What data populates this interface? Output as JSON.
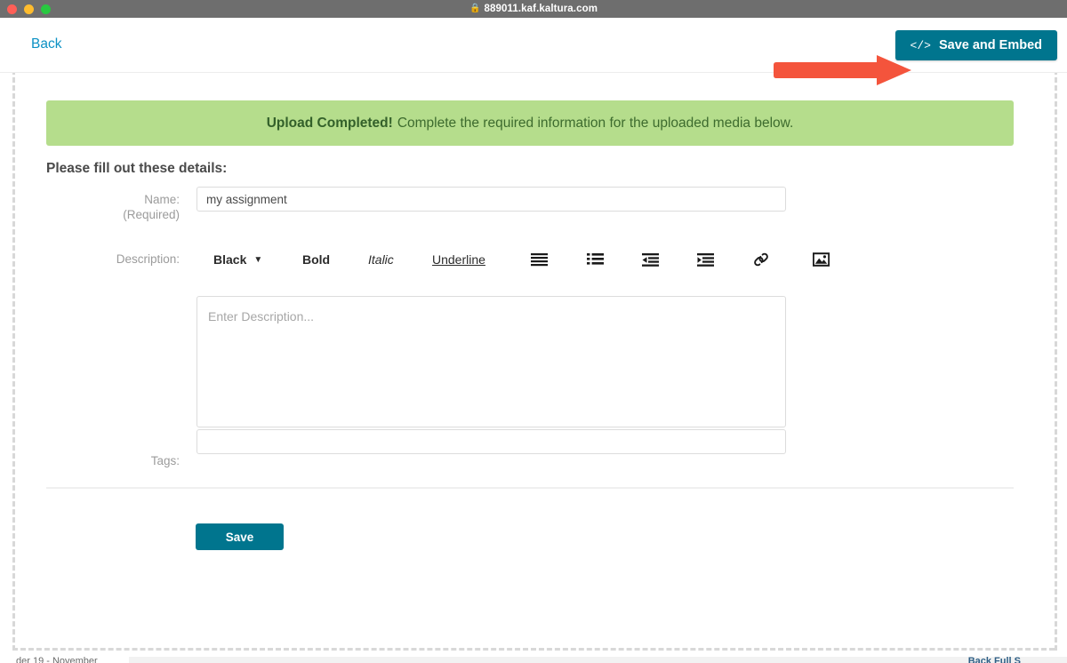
{
  "window": {
    "url_title": "889011.kaf.kaltura.com",
    "lock_icon": "lock-icon",
    "traffic_lights": [
      "close",
      "minimize",
      "maximize"
    ]
  },
  "header": {
    "back_label": "Back",
    "save_embed_label": "Save and Embed",
    "save_embed_icon": "code-brackets-icon",
    "save_embed_color": "#00758e",
    "annotation": "red-arrow-pointing-to-save-and-embed"
  },
  "banner": {
    "strong_text": "Upload Completed!",
    "message": "Complete the required information for the uploaded media below.",
    "background_color": "#b5dd8c",
    "text_color": "#3d6b2e"
  },
  "form": {
    "title": "Please fill out these details:",
    "name": {
      "label": "Name:",
      "required_note": "(Required)",
      "value": "my assignment",
      "placeholder": ""
    },
    "description": {
      "label": "Description:",
      "value": "",
      "placeholder": "Enter Description..."
    },
    "tags": {
      "label": "Tags:",
      "value": "",
      "placeholder": ""
    },
    "save_label": "Save"
  },
  "editor_toolbar": {
    "color_value": "Black",
    "caret_icon": "chevron-down-icon",
    "bold_label": "Bold",
    "italic_label": "Italic",
    "underline_label": "Underline",
    "icons": [
      "numbered-list-icon",
      "bulleted-list-icon",
      "outdent-icon",
      "indent-icon",
      "link-icon",
      "image-icon"
    ]
  },
  "bottom_strip": {
    "left_text": "der 19 - November",
    "right_text": "Back Full S"
  }
}
